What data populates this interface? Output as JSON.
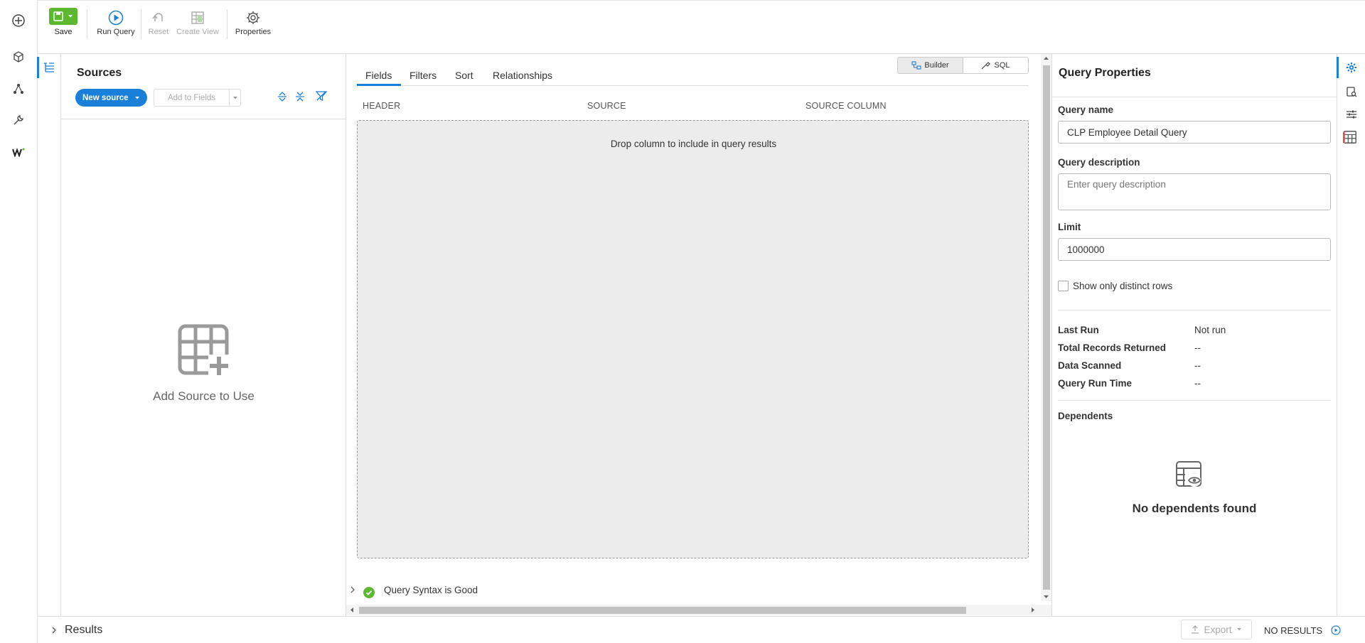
{
  "toolbar": {
    "save": "Save",
    "run_query": "Run Query",
    "reset": "Reset",
    "create_view": "Create View",
    "properties": "Properties"
  },
  "sources": {
    "title": "Sources",
    "new_source": "New source",
    "add_to_fields": "Add to Fields",
    "empty_label": "Add Source to Use"
  },
  "main": {
    "tabs": [
      "Fields",
      "Filters",
      "Sort",
      "Relationships"
    ],
    "active_tab": "Fields",
    "mode": {
      "builder": "Builder",
      "sql": "SQL",
      "active": "Builder"
    },
    "columns": [
      "HEADER",
      "SOURCE",
      "SOURCE COLUMN"
    ],
    "dropzone_text": "Drop column to include in query results",
    "syntax_status": "Query Syntax is Good"
  },
  "properties": {
    "title": "Query Properties",
    "query_name_label": "Query name",
    "query_name_value": "CLP Employee Detail Query",
    "query_desc_label": "Query description",
    "query_desc_placeholder": "Enter query description",
    "limit_label": "Limit",
    "limit_value": "1000000",
    "distinct_label": "Show only distinct rows",
    "distinct_checked": false,
    "stats": [
      {
        "label": "Last Run",
        "value": "Not run"
      },
      {
        "label": "Total Records Returned",
        "value": "--"
      },
      {
        "label": "Data Scanned",
        "value": "--"
      },
      {
        "label": "Query Run Time",
        "value": "--"
      }
    ],
    "dependents_label": "Dependents",
    "no_dependents": "No dependents found"
  },
  "bottom": {
    "results": "Results",
    "export": "Export",
    "status": "NO RESULTS"
  },
  "colors": {
    "accent": "#1a7fd9",
    "save_green": "#5cb82e",
    "success": "#5cb82e"
  }
}
